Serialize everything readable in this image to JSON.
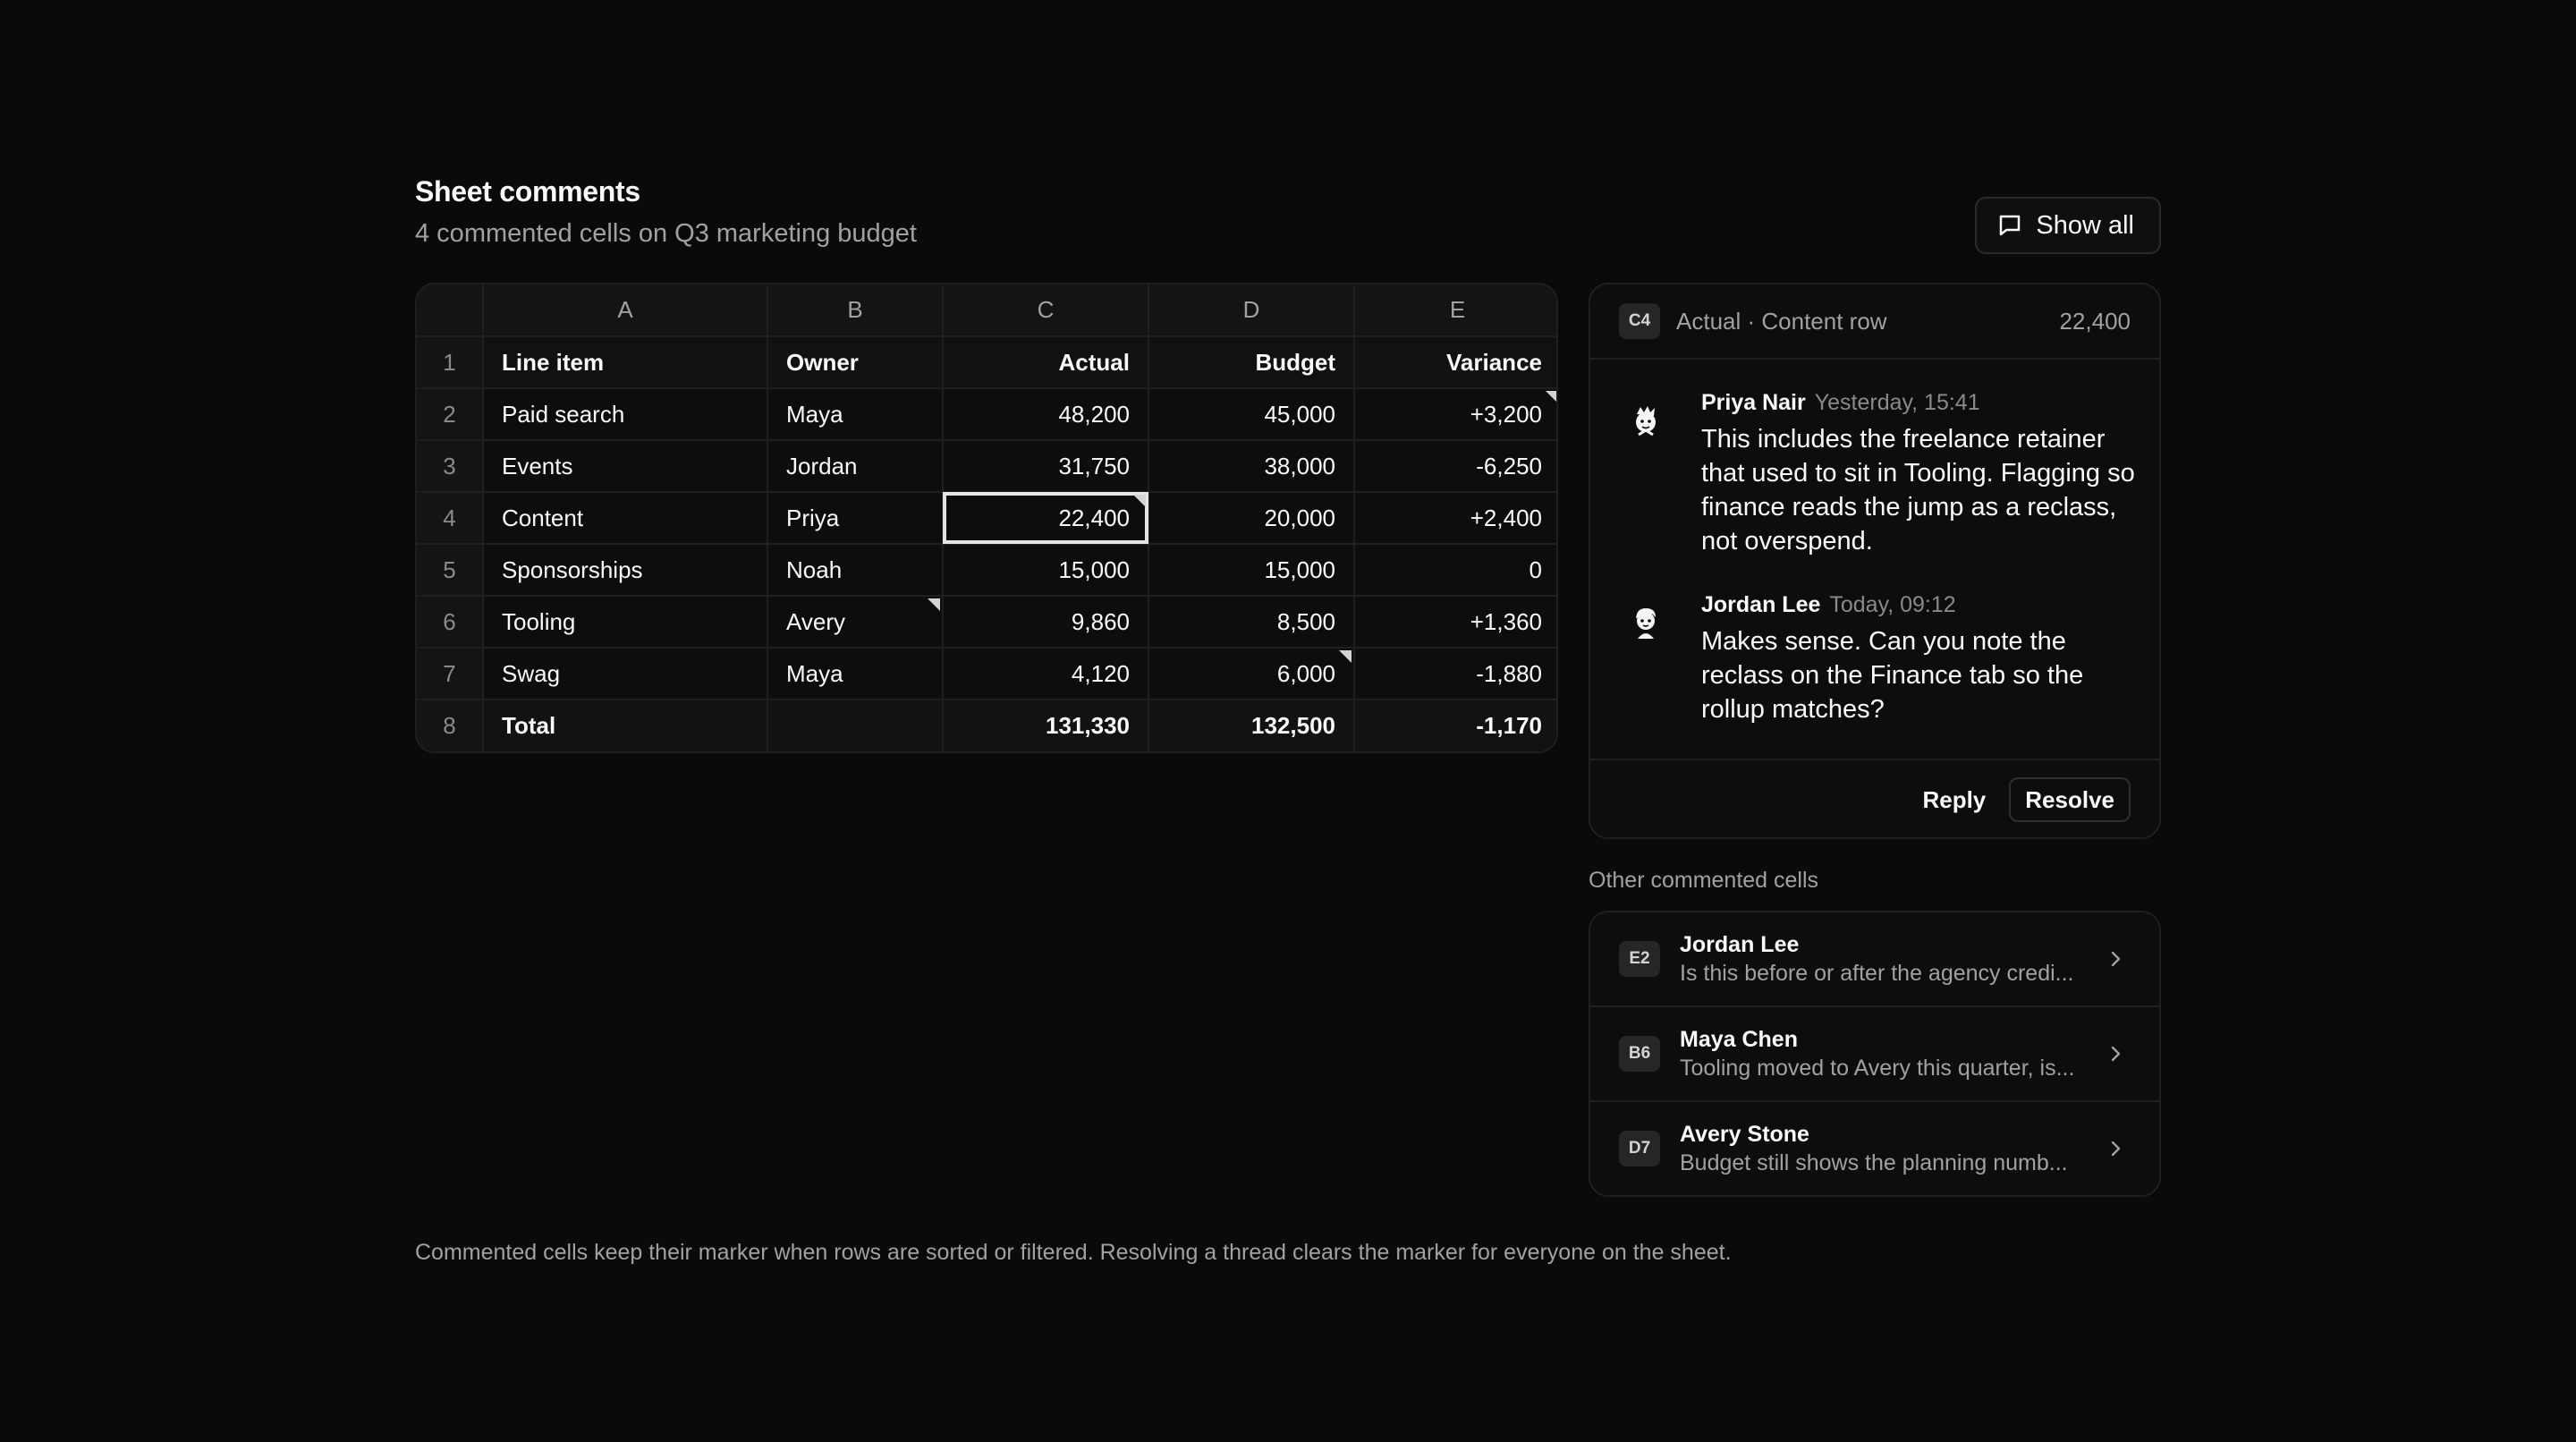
{
  "header": {
    "title": "Sheet comments",
    "subtitle": "4 commented cells on Q3 marketing budget",
    "show_all_label": "Show all",
    "show_all_icon": "message-square-icon"
  },
  "sheet": {
    "columns": [
      "A",
      "B",
      "C",
      "D",
      "E"
    ],
    "rows": [
      {
        "n": "1",
        "a": "Line item",
        "b": "Owner",
        "c": "Actual",
        "d": "Budget",
        "e": "Variance"
      },
      {
        "n": "2",
        "a": "Paid search",
        "b": "Maya",
        "c": "48,200",
        "d": "45,000",
        "e": "+3,200"
      },
      {
        "n": "3",
        "a": "Events",
        "b": "Jordan",
        "c": "31,750",
        "d": "38,000",
        "e": "-6,250"
      },
      {
        "n": "4",
        "a": "Content",
        "b": "Priya",
        "c": "22,400",
        "d": "20,000",
        "e": "+2,400"
      },
      {
        "n": "5",
        "a": "Sponsorships",
        "b": "Noah",
        "c": "15,000",
        "d": "15,000",
        "e": "0"
      },
      {
        "n": "6",
        "a": "Tooling",
        "b": "Avery",
        "c": "9,860",
        "d": "8,500",
        "e": "+1,360"
      },
      {
        "n": "7",
        "a": "Swag",
        "b": "Maya",
        "c": "4,120",
        "d": "6,000",
        "e": "-1,880"
      },
      {
        "n": "8",
        "a": "Total",
        "b": "",
        "c": "131,330",
        "d": "132,500",
        "e": "-1,170"
      }
    ]
  },
  "thread": {
    "cell": "C4",
    "context": "Actual · Content row",
    "value": "22,400",
    "comments": [
      {
        "author": "Priya Nair",
        "time": "Yesterday, 15:41",
        "body": "This includes the freelance retainer that used to sit in Tooling. Flagging so finance reads the jump as a reclass, not overspend."
      },
      {
        "author": "Jordan Lee",
        "time": "Today, 09:12",
        "body": "Makes sense. Can you note the reclass on the Finance tab so the rollup matches?"
      }
    ],
    "reply_label": "Reply",
    "resolve_label": "Resolve"
  },
  "other": {
    "label": "Other commented cells",
    "items": [
      {
        "cell": "E2",
        "author": "Jordan Lee",
        "preview": "Is this before or after the agency credi..."
      },
      {
        "cell": "B6",
        "author": "Maya Chen",
        "preview": "Tooling moved to Avery this quarter, is..."
      },
      {
        "cell": "D7",
        "author": "Avery Stone",
        "preview": "Budget still shows the planning numb..."
      }
    ]
  },
  "footer": "Commented cells keep their marker when rows are sorted or filtered. Resolving a thread clears the marker for everyone on the sheet."
}
